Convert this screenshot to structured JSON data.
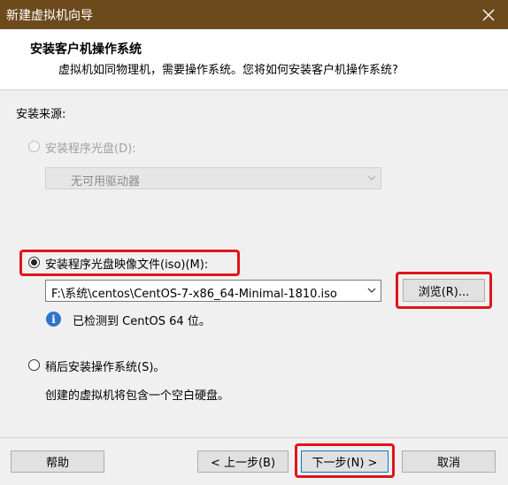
{
  "window": {
    "title": "新建虚拟机向导",
    "close_glyph": "✕"
  },
  "header": {
    "title": "安装客户机操作系统",
    "subtitle": "虚拟机如同物理机，需要操作系统。您将如何安装客户机操作系统?"
  },
  "source": {
    "label": "安装来源:",
    "disc": {
      "label": "安装程序光盘(D):",
      "selected": false,
      "enabled": false,
      "dropdown_value": "无可用驱动器"
    },
    "iso": {
      "label": "安装程序光盘映像文件(iso)(M):",
      "selected": true,
      "path": "F:\\系统\\centos\\CentOS-7-x86_64-Minimal-1810.iso",
      "browse_label": "浏览(R)...",
      "detected_text": "已检测到 CentOS 64 位。"
    },
    "later": {
      "label": "稍后安装操作系统(S)。",
      "selected": false,
      "description": "创建的虚拟机将包含一个空白硬盘。"
    }
  },
  "footer": {
    "help_label": "帮助",
    "back_label": "< 上一步(B)",
    "next_label": "下一步(N) >",
    "cancel_label": "取消"
  },
  "colors": {
    "titlebar": "#6d4a1c",
    "highlight": "#e0151a",
    "primary_border": "#0078d7"
  }
}
